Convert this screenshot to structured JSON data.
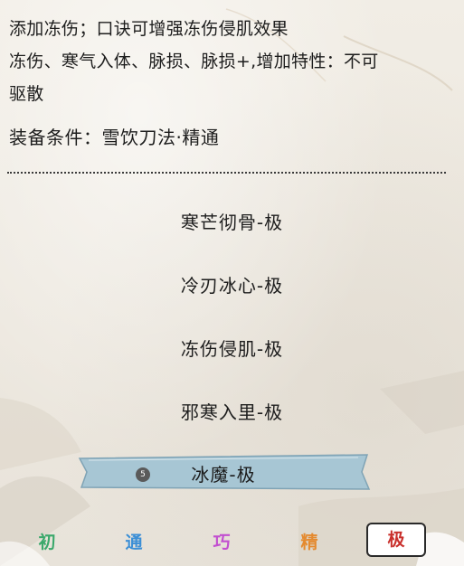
{
  "description": {
    "line1": "添加冻伤；口诀可增强冻伤侵肌效果",
    "line2": "冻伤、寒气入体、脉损、脉损+,增加特性：不可",
    "line3": "驱散"
  },
  "equip_requirement": "装备条件：雪饮刀法·精通",
  "skills": [
    {
      "label": "寒芒彻骨-极"
    },
    {
      "label": "冷刃冰心-极"
    },
    {
      "label": "冻伤侵肌-极"
    },
    {
      "label": "邪寒入里-极"
    }
  ],
  "selected_skill": {
    "label": "冰魔-极",
    "badge": "5"
  },
  "tiers": [
    {
      "label": "初",
      "color": "#3aa86b"
    },
    {
      "label": "通",
      "color": "#3c8fd6"
    },
    {
      "label": "巧",
      "color": "#c24fd0"
    },
    {
      "label": "精",
      "color": "#e48a2f"
    },
    {
      "label": "极",
      "color": "#c9302c"
    }
  ],
  "colors": {
    "banner": "#a7c6d4",
    "banner_edge": "#7fa3b5"
  }
}
